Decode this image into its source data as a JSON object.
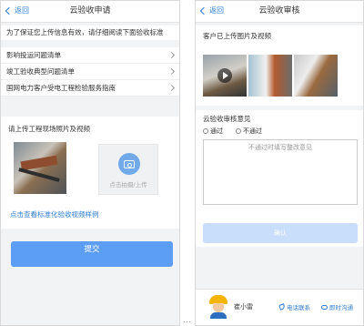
{
  "left": {
    "nav": {
      "back_label": "返回",
      "title": "云验收申请"
    },
    "notice": "为了保证您上传信息有效，请仔细阅读下面验收标准",
    "links": [
      "影响投运问题清单",
      "竣工验收典型问题清单",
      "国网电力客户受电工程检验服务指南"
    ],
    "upload": {
      "label": "请上传工程现场照片及视频",
      "add_tile_text": "点击拍摄/上传",
      "sample_link": "点击查看标准化验收视频样例"
    },
    "submit_label": "提交"
  },
  "right": {
    "nav": {
      "back_label": "返回",
      "title": "云验收审核"
    },
    "media_label": "客户已上传图片及视频",
    "opinion_label": "云验收审核意见",
    "radio_pass": "通过",
    "radio_fail": "不通过",
    "textarea_placeholder": "不通过时填写整改意见",
    "confirm_label": "确认",
    "footer": {
      "name": "崔小雷",
      "call_label": "电话联系",
      "chat_label": "即时沟通"
    }
  },
  "separator": "..."
}
